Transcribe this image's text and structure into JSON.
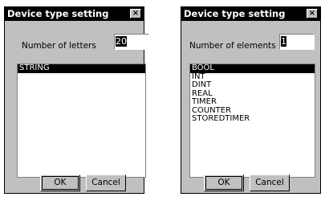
{
  "left_dialog": {
    "title": "Device type setting",
    "close_symbol": "×",
    "field_label": "Number of letters",
    "field_value": "20",
    "list_items": [
      "STRING"
    ],
    "selected_index": 0,
    "ok_label": "OK",
    "cancel_label": "Cancel"
  },
  "right_dialog": {
    "title": "Device type setting",
    "close_symbol": "×",
    "field_label": "Number of elements",
    "field_value": "1",
    "list_items": [
      "BOOL",
      "INT",
      "DINT",
      "REAL",
      "TIMER",
      "COUNTER",
      "STOREDTIMER"
    ],
    "selected_index": 0,
    "ok_label": "OK",
    "cancel_label": "Cancel"
  }
}
